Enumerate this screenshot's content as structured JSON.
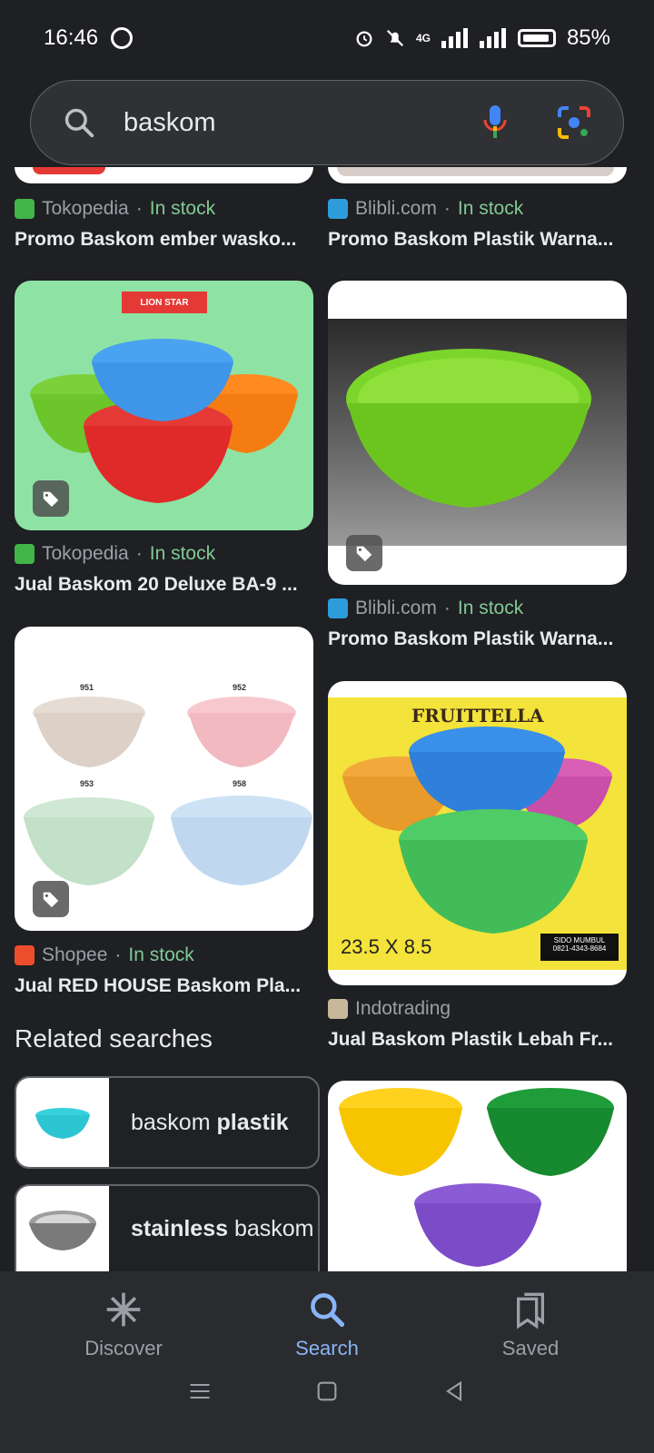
{
  "status": {
    "time": "16:46",
    "battery": "85%",
    "network": "4G"
  },
  "search": {
    "query": "baskom"
  },
  "results": [
    {
      "source": "Tokopedia",
      "stock": "In stock",
      "title": "Promo Baskom ember wasko..."
    },
    {
      "source": "Blibli.com",
      "stock": "In stock",
      "title": "Promo Baskom Plastik Warna..."
    },
    {
      "source": "Tokopedia",
      "stock": "In stock",
      "title": "Jual Baskom 20 Deluxe BA-9 ...",
      "image_text": "LION STAR"
    },
    {
      "source": "Blibli.com",
      "stock": "In stock",
      "title": "Promo Baskom Plastik Warna..."
    },
    {
      "source": "Shopee",
      "stock": "In stock",
      "title": "Jual RED HOUSE Baskom Pla...",
      "image_labels": [
        "951",
        "952",
        "953",
        "958"
      ]
    },
    {
      "source": "Indotrading",
      "title": "Jual Baskom Plastik Lebah Fr...",
      "image_text": {
        "brand": "FRUITTELLA",
        "size": "23.5 X 8.5",
        "seller": "SIDO MUMBUL",
        "phone": "0821-4343-8684"
      }
    }
  ],
  "separator": "·",
  "related": {
    "heading": "Related searches",
    "items": [
      {
        "prefix": "baskom ",
        "bold": "plastik",
        "suffix": ""
      },
      {
        "prefix": "",
        "bold": "stainless",
        "suffix": " baskom"
      }
    ]
  },
  "nav": {
    "discover": "Discover",
    "search": "Search",
    "saved": "Saved"
  },
  "colors": {
    "accent": "#8ab4f8",
    "instock": "#81c995",
    "bg": "#1f2023"
  }
}
